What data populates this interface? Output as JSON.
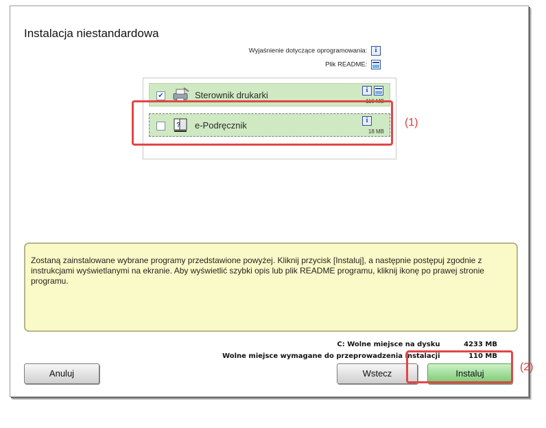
{
  "window": {
    "title": "Instalacja niestandardowa"
  },
  "legend": {
    "explanation_label": "Wyjaśnienie dotyczące oprogramowania:",
    "explanation_icon": "info-icon",
    "readme_label": "Plik README:",
    "readme_icon": "readme-icon"
  },
  "components": [
    {
      "label": "Sterownik drukarki",
      "checked": true,
      "check_glyph": "✔",
      "size": "110 MB",
      "icon": "printer-driver-icon",
      "has_readme": true
    },
    {
      "label": "e-Podręcznik",
      "checked": false,
      "check_glyph": "",
      "size": "18 MB",
      "icon": "help-book-icon",
      "has_readme": false
    }
  ],
  "description": "Zostaną zainstalowane wybrane programy przedstawione powyżej. Kliknij przycisk [Instaluj], a następnie postępuj zgodnie z instrukcjami wyświetlanymi na ekranie. Aby wyświetlić szybki opis lub plik README programu, kliknij ikonę po prawej stronie programu.",
  "space": {
    "free_label": "C: Wolne miejsce na dysku",
    "free_value": "4233 MB",
    "required_label": "Wolne miejsce wymagane do przeprowadzenia instalacji",
    "required_value": "110 MB"
  },
  "buttons": {
    "cancel": "Anuluj",
    "back": "Wstecz",
    "install": "Instaluj"
  },
  "annotations": {
    "label1": "(1)",
    "label2": "(2)",
    "color": "#e34545"
  }
}
